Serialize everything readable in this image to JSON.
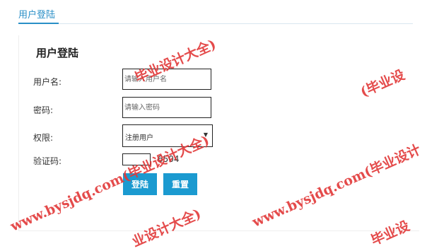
{
  "header": {
    "tab_label": "用户登陆"
  },
  "form": {
    "title": "用户登陆",
    "username_label": "用户名:",
    "username_placeholder": "请输入用户名",
    "password_label": "密码:",
    "password_placeholder": "请输入密码",
    "role_label": "权限:",
    "role_value": "注册用户",
    "captcha_label": "验证码:",
    "captcha_code": "6504",
    "login_button": "登陆",
    "reset_button": "重置"
  },
  "watermark": {
    "text_full": "www.bysjdq.com(毕业设计大全)",
    "text_mid": "www.bysjdq.com(毕业设计",
    "text_tail": "毕业设计大全)",
    "text_right": "(毕业设",
    "text_bottom": "业设计大全)",
    "text_bottom_right": "毕业设",
    "color": "#e23838"
  }
}
